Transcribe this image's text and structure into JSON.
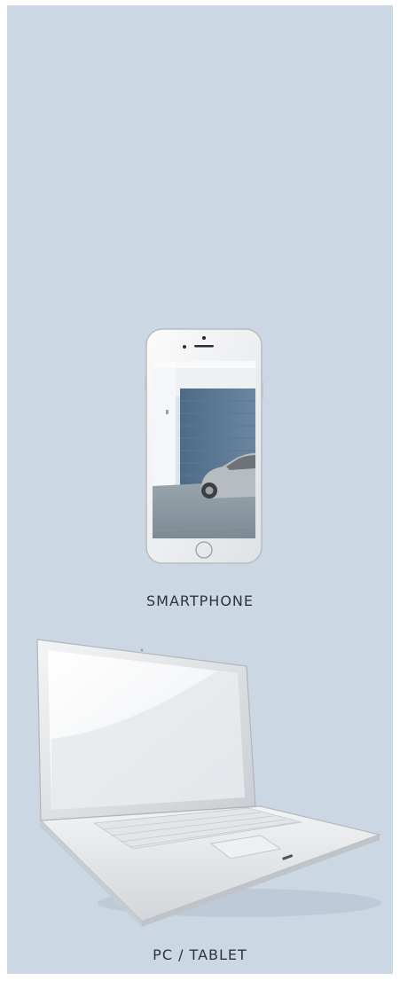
{
  "devices": [
    {
      "label": "SMARTPHONE",
      "icon": "smartphone-icon"
    },
    {
      "label": "PC / TABLET",
      "icon": "laptop-icon"
    }
  ],
  "colors": {
    "panel_background": "#cbd8e4",
    "label_text": "#2f3338"
  }
}
